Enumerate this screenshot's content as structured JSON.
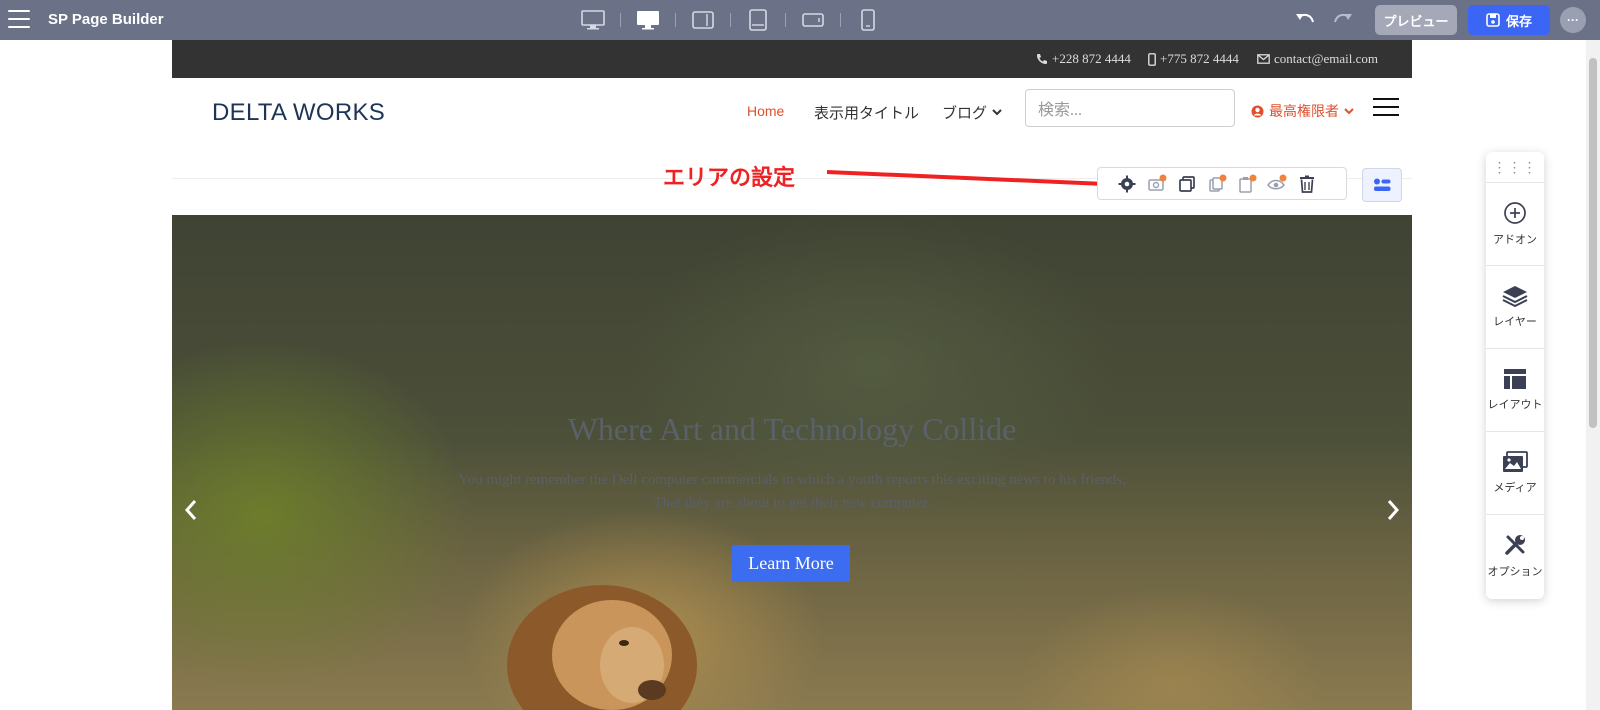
{
  "app": {
    "title": "SP Page Builder"
  },
  "header": {
    "devices": [
      "desktop-wide-icon",
      "desktop-icon",
      "tablet-landscape-icon",
      "tablet-portrait-icon",
      "mobile-landscape-icon",
      "mobile-portrait-icon"
    ],
    "preview_label": "プレビュー",
    "save_label": "保存",
    "more_label": "···"
  },
  "site": {
    "phone1": "+228 872 4444",
    "phone2": "+775 872 4444",
    "email": "contact@email.com",
    "logo": "DELTA WORKS",
    "nav": {
      "home": "Home",
      "title": "表示用タイトル",
      "blog": "ブログ"
    },
    "search_placeholder": "検索...",
    "account": "最高権限者"
  },
  "annotation": {
    "label": "エリアの設定",
    "color": "#ee2222"
  },
  "hero": {
    "title": "Where Art and Technology Collide",
    "subtitle_line1": "You might remember the Dell computer commercials in which a youth reports this exciting news to his friends.",
    "subtitle_line2": "That they are about to get their new computer.",
    "button": "Learn More"
  },
  "right_panel": {
    "items": [
      {
        "label": "アドオン",
        "icon": "plus-circle-icon"
      },
      {
        "label": "レイヤー",
        "icon": "layers-icon"
      },
      {
        "label": "レイアウト",
        "icon": "layout-icon"
      },
      {
        "label": "メディア",
        "icon": "media-icon"
      },
      {
        "label": "オプション",
        "icon": "tools-icon"
      }
    ]
  },
  "colors": {
    "topbar": "#6b7187",
    "accent": "#3b66f5",
    "nav_active": "#e0502b"
  }
}
